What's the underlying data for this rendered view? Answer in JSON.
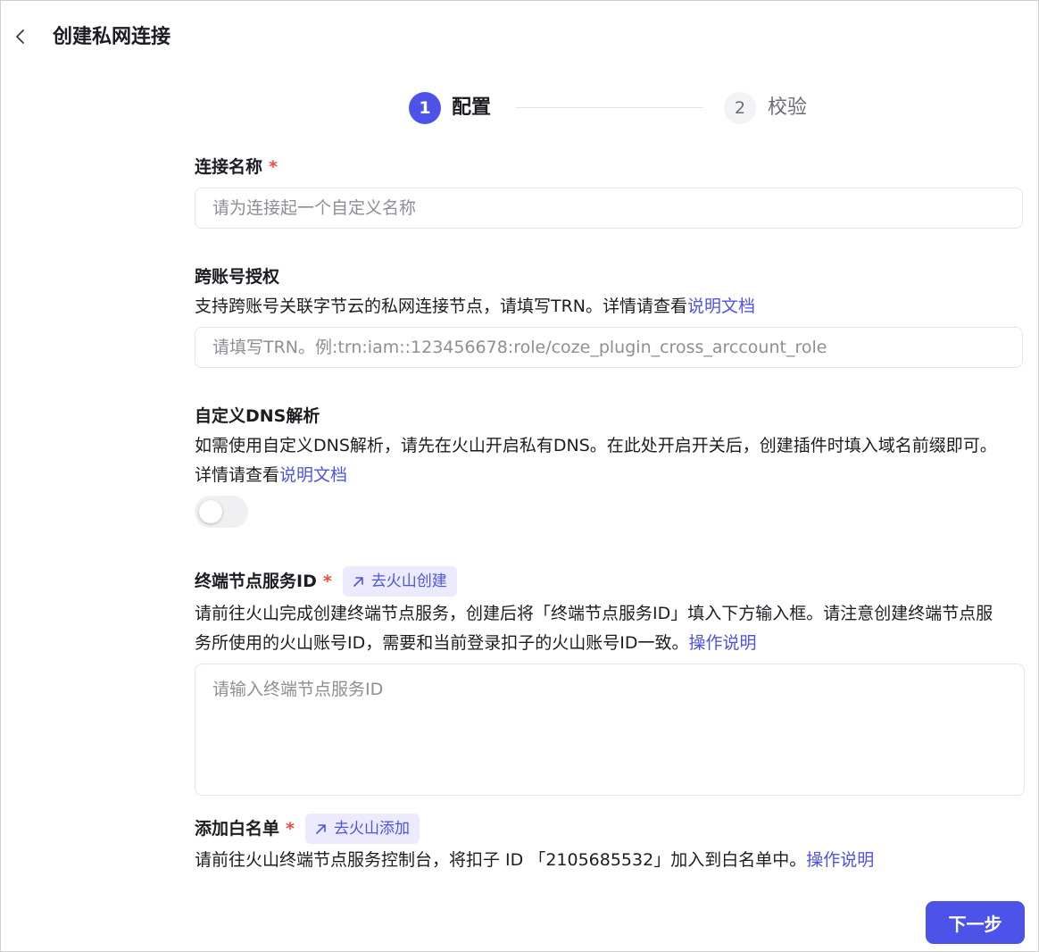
{
  "header": {
    "title": "创建私网连接"
  },
  "steps": [
    {
      "number": "1",
      "label": "配置"
    },
    {
      "number": "2",
      "label": "校验"
    }
  ],
  "connection_name": {
    "label": "连接名称",
    "required_mark": "*",
    "placeholder": "请为连接起一个自定义名称",
    "value": ""
  },
  "cross_account": {
    "label": "跨账号授权",
    "description": "支持跨账号关联字节云的私网连接节点，请填写TRN。详情请查看",
    "link": "说明文档",
    "placeholder": "请填写TRN。例:trn:iam::123456678:role/coze_plugin_cross_arccount_role",
    "value": ""
  },
  "custom_dns": {
    "label": "自定义DNS解析",
    "description": "如需使用自定义DNS解析，请先在火山开启私有DNS。在此处开启开关后，创建插件时填入域名前缀即可。详情请查看",
    "link": "说明文档",
    "toggle_on": false
  },
  "endpoint_service": {
    "label": "终端节点服务ID",
    "required_mark": "*",
    "button": "去火山创建",
    "description": "请前往火山完成创建终端节点服务，创建后将「终端节点服务ID」填入下方输入框。请注意创建终端节点服务所使用的火山账号ID，需要和当前登录扣子的火山账号ID一致。",
    "link": "操作说明",
    "placeholder": "请输入终端节点服务ID",
    "value": ""
  },
  "whitelist": {
    "label": "添加白名单",
    "required_mark": "*",
    "button": "去火山添加",
    "description": "请前往火山终端节点服务控制台，将扣子 ID 「2105685532」加入到白名单中。",
    "link": "操作说明"
  },
  "footer": {
    "next_label": "下一步"
  },
  "colors": {
    "accent": "#4d53e8",
    "required": "#f5493f",
    "text": "#1d1c23"
  }
}
